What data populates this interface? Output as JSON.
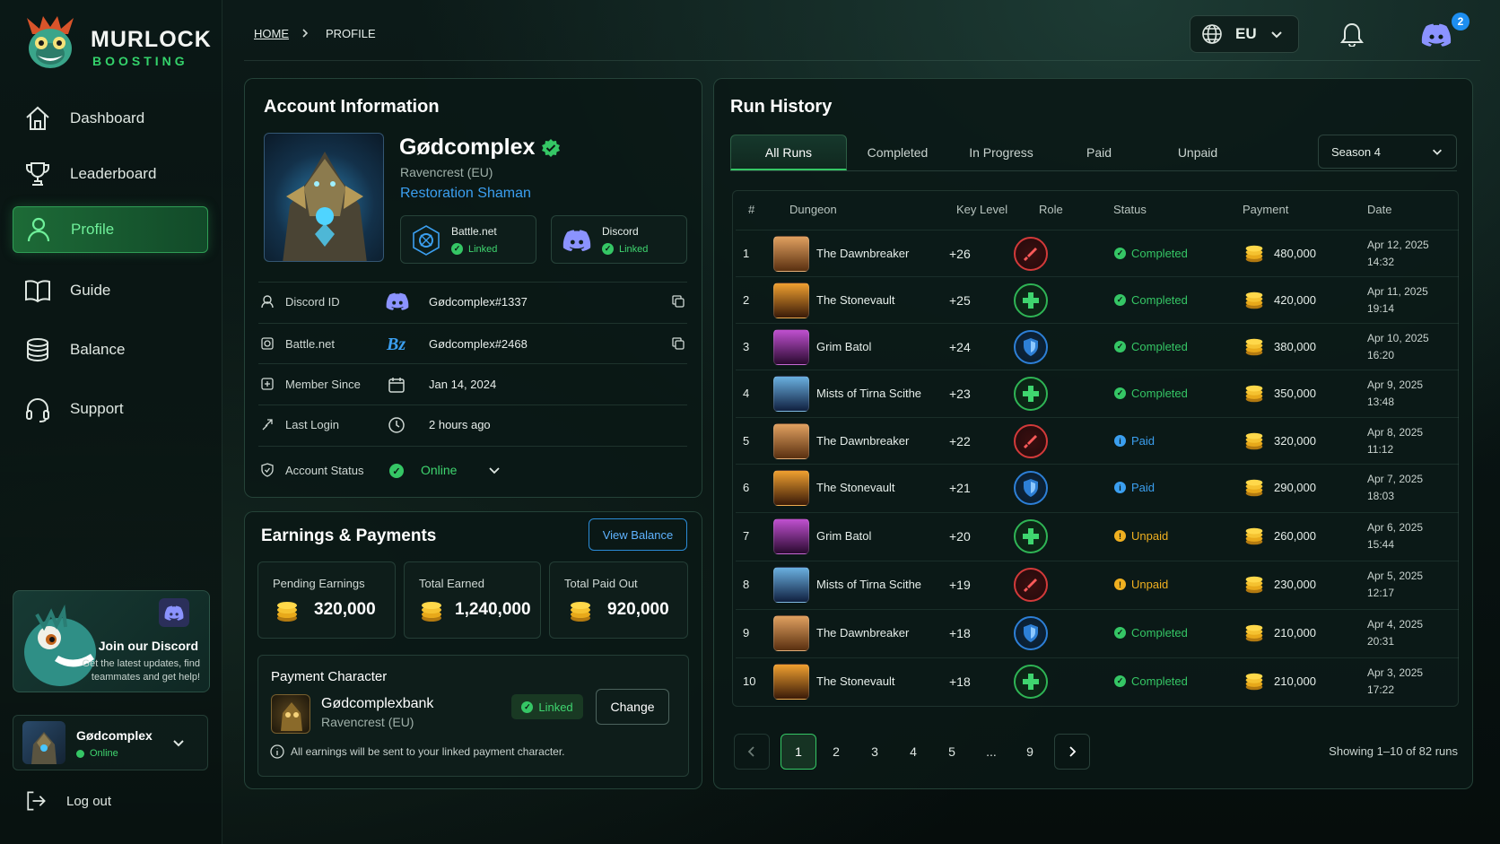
{
  "brand": {
    "name_line1": "MURLOCK",
    "name_line2": "BOOSTING"
  },
  "nav": [
    {
      "label": "Dashboard",
      "icon": "home-icon",
      "active": false
    },
    {
      "label": "Leaderboard",
      "icon": "trophy-icon",
      "active": false
    },
    {
      "label": "Profile",
      "icon": "user-icon",
      "active": true
    },
    {
      "label": "Guide",
      "icon": "book-icon",
      "active": false
    },
    {
      "label": "Balance",
      "icon": "coins-stack-icon",
      "active": false
    },
    {
      "label": "Support",
      "icon": "headset-icon",
      "active": false
    }
  ],
  "promo": {
    "title": "Join our Discord",
    "subtitle": "Get the latest updates, find teammates and get help!"
  },
  "user": {
    "name": "Gødcomplex",
    "status": "Online"
  },
  "logout_label": "Log out",
  "breadcrumb": {
    "home": "HOME",
    "current": "PROFILE"
  },
  "topbar": {
    "region": "EU",
    "discord_badge": "2"
  },
  "account": {
    "title": "Account Information",
    "name": "Gødcomplex",
    "realm": "Ravencrest (EU)",
    "spec": "Restoration Shaman",
    "bnet_badge": {
      "label": "Battle.net",
      "status": "Linked"
    },
    "discord_badge": {
      "label": "Discord",
      "status": "Linked"
    },
    "rows": [
      {
        "label": "Discord ID",
        "value": "Gødcomplex#1337"
      },
      {
        "label": "Battle.net",
        "value": "Gødcomplex#2468"
      },
      {
        "label": "Member Since",
        "value": "Jan 14, 2024"
      },
      {
        "label": "Last Login",
        "value": "2 hours ago"
      },
      {
        "label": "Account Status",
        "value": "Online"
      }
    ]
  },
  "earnings": {
    "title": "Earnings & Payments",
    "view_balance": "View Balance",
    "stats": [
      {
        "label": "Pending Earnings",
        "value": "320,000"
      },
      {
        "label": "Total Earned",
        "value": "1,240,000"
      },
      {
        "label": "Total Paid Out",
        "value": "920,000"
      }
    ],
    "payment_character": {
      "title": "Payment Character",
      "name": "Gødcomplexbank",
      "realm": "Ravencrest (EU)",
      "status": "Linked",
      "change_label": "Change"
    },
    "note": "All earnings will be sent to your linked payment character."
  },
  "runs": {
    "title": "Run History",
    "tabs": [
      "All Runs",
      "Completed",
      "In Progress",
      "Paid",
      "Unpaid"
    ],
    "season": "Season 4",
    "columns": [
      "#",
      "Dungeon",
      "Key Level",
      "Role",
      "Status",
      "Payment",
      "Date"
    ],
    "rows": [
      {
        "n": "1",
        "dungeon": "The Dawnbreaker",
        "key": "+26",
        "role": "dps",
        "status": "Completed",
        "payment": "480,000",
        "date": "Apr 12, 2025",
        "time": "14:32"
      },
      {
        "n": "2",
        "dungeon": "The Stonevault",
        "key": "+25",
        "role": "heal",
        "status": "Completed",
        "payment": "420,000",
        "date": "Apr 11, 2025",
        "time": "19:14"
      },
      {
        "n": "3",
        "dungeon": "Grim Batol",
        "key": "+24",
        "role": "tank",
        "status": "Completed",
        "payment": "380,000",
        "date": "Apr 10, 2025",
        "time": "16:20"
      },
      {
        "n": "4",
        "dungeon": "Mists of Tirna Scithe",
        "key": "+23",
        "role": "heal",
        "status": "Completed",
        "payment": "350,000",
        "date": "Apr 9, 2025",
        "time": "13:48"
      },
      {
        "n": "5",
        "dungeon": "The Dawnbreaker",
        "key": "+22",
        "role": "dps",
        "status": "Paid",
        "payment": "320,000",
        "date": "Apr 8, 2025",
        "time": "11:12"
      },
      {
        "n": "6",
        "dungeon": "The Stonevault",
        "key": "+21",
        "role": "tank",
        "status": "Paid",
        "payment": "290,000",
        "date": "Apr 7, 2025",
        "time": "18:03"
      },
      {
        "n": "7",
        "dungeon": "Grim Batol",
        "key": "+20",
        "role": "heal",
        "status": "Unpaid",
        "payment": "260,000",
        "date": "Apr 6, 2025",
        "time": "15:44"
      },
      {
        "n": "8",
        "dungeon": "Mists of Tirna Scithe",
        "key": "+19",
        "role": "dps",
        "status": "Unpaid",
        "payment": "230,000",
        "date": "Apr 5, 2025",
        "time": "12:17"
      },
      {
        "n": "9",
        "dungeon": "The Dawnbreaker",
        "key": "+18",
        "role": "tank",
        "status": "Completed",
        "payment": "210,000",
        "date": "Apr 4, 2025",
        "time": "20:31"
      },
      {
        "n": "10",
        "dungeon": "The Stonevault",
        "key": "+18",
        "role": "heal",
        "status": "Completed",
        "payment": "210,000",
        "date": "Apr 3, 2025",
        "time": "17:22"
      }
    ],
    "pages": [
      "1",
      "2",
      "3",
      "4",
      "5",
      "...",
      "9"
    ],
    "current_page": "1",
    "showing": "Showing 1–10 of 82 runs"
  },
  "colors": {
    "accent": "#35c665",
    "link": "#3b9ff0",
    "paid": "#3b9ff0",
    "unpaid": "#f0b020",
    "danger": "#d23a3a"
  }
}
